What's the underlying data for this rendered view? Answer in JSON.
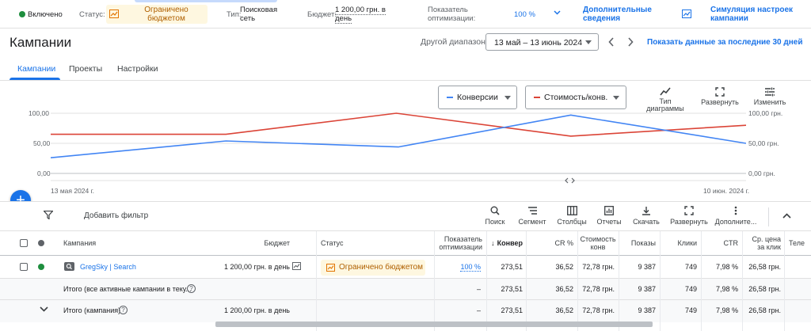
{
  "topbar": {
    "status_on": "Включено",
    "status_label": "Статус:",
    "status_value": "Ограничено бюджетом",
    "type_label": "Тип:",
    "type_value": "Поисковая сеть",
    "budget_label": "Бюджет:",
    "budget_value": "1 200,00 грн. в день",
    "optim_label": "Показатель оптимизации:",
    "optim_value": "100 %",
    "more_details": "Дополнительные сведения",
    "simulation": "Симуляция настроек кампании"
  },
  "header": {
    "title": "Кампании",
    "range_label": "Другой диапазон",
    "range_value": "13 май – 13 июнь 2024",
    "show_last_30": "Показать данные за последние 30 дней"
  },
  "tabs": [
    "Кампании",
    "Проекты",
    "Настройки"
  ],
  "chart_controls": {
    "metric1": "Конверсии",
    "metric2": "Стоимость/конв.",
    "chart_type": "Тип диаграммы",
    "expand": "Развернуть",
    "change": "Изменить",
    "metric1_color": "#4285f4",
    "metric2_color": "#db4437"
  },
  "chart_data": {
    "type": "line",
    "x_start_label": "13 мая 2024 г.",
    "x_end_label": "10 июн. 2024 г.",
    "y_left_ticks": [
      "100,00",
      "50,00",
      "0,00"
    ],
    "y_right_ticks": [
      "100,00 грн.",
      "50,00 грн.",
      "0,00 грн."
    ],
    "ylim_left": [
      0,
      100
    ],
    "ylim_right": [
      0,
      100
    ],
    "series": [
      {
        "name": "Конверсии",
        "color": "#4285f4",
        "values": [
          26,
          54,
          44,
          97,
          50
        ]
      },
      {
        "name": "Стоимость/конв.",
        "color": "#db4437",
        "values": [
          65,
          65,
          100,
          63,
          80
        ]
      }
    ],
    "x_positions": [
      0,
      0.25,
      0.5,
      0.75,
      1
    ],
    "extra_points": {
      "blue": [
        [
          0,
          26
        ],
        [
          0.252,
          54
        ],
        [
          0.5,
          44
        ],
        [
          0.748,
          97
        ],
        [
          1,
          50
        ]
      ],
      "red": [
        [
          0,
          65
        ],
        [
          0.252,
          65
        ],
        [
          0.497,
          100
        ],
        [
          0.748,
          62
        ],
        [
          1,
          80
        ]
      ]
    }
  },
  "toolbar": {
    "add_filter": "Добавить фильтр",
    "search": "Поиск",
    "segment": "Сегмент",
    "columns": "Столбцы",
    "reports": "Отчеты",
    "download": "Скачать",
    "expand": "Развернуть",
    "more": "Дополните..."
  },
  "table": {
    "headers": {
      "campaign": "Кампания",
      "budget": "Бюджет",
      "status": "Статус",
      "optim": "Показатель оптимизации",
      "conv": "Конвер",
      "cr": "CR %",
      "cost_conv": "Стоимость конв",
      "impr": "Показы",
      "clicks": "Клики",
      "ctr": "CTR",
      "avg_cpc": "Ср. цена за клик",
      "tel": "Теле"
    },
    "row": {
      "name": "GregSky | Search",
      "budget": "1 200,00 грн. в день",
      "status": "Ограничено бюджетом",
      "optim": "100 %",
      "conv": "273,51",
      "cr": "36,52",
      "cost_conv": "72,78 грн.",
      "impr": "9 387",
      "clicks": "749",
      "ctr": "7,98 %",
      "avg_cpc": "26,58 грн."
    },
    "total_active": {
      "label": "Итого (все активные кампании в теку...",
      "optim": "–",
      "conv": "273,51",
      "cr": "36,52",
      "cost_conv": "72,78 грн.",
      "impr": "9 387",
      "clicks": "749",
      "ctr": "7,98 %",
      "avg_cpc": "26,58 грн."
    },
    "total_campaign": {
      "label": "Итого (кампания)",
      "budget": "1 200,00 грн. в день",
      "optim": "–",
      "conv": "273,51",
      "cr": "36,52",
      "cost_conv": "72,78 грн.",
      "impr": "9 387",
      "clicks": "749",
      "ctr": "7,98 %",
      "avg_cpc": "26,58 грн."
    }
  }
}
